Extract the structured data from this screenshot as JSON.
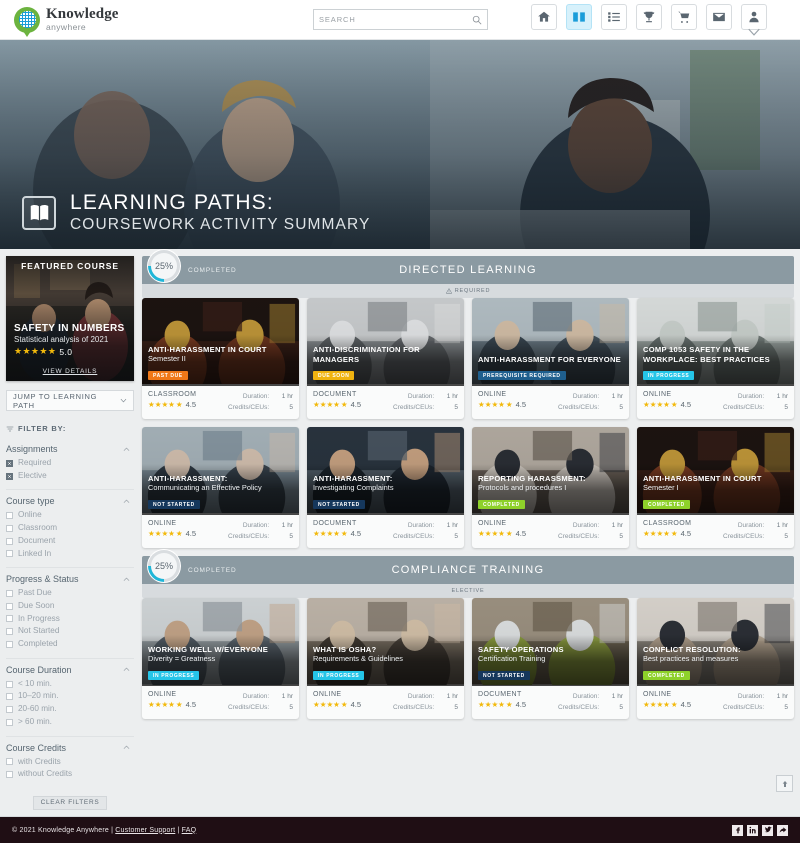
{
  "header": {
    "logo": {
      "line1": "Knowledge",
      "line2": "anywhere",
      "icon": "globe-logo-icon"
    },
    "search": {
      "placeholder": "SEARCH",
      "value": "",
      "icon": "search-icon"
    },
    "nav": [
      {
        "name": "home",
        "icon": "home-icon",
        "active": false
      },
      {
        "name": "catalog",
        "icon": "book-icon",
        "active": true
      },
      {
        "name": "transcript",
        "icon": "list-icon",
        "active": false
      },
      {
        "name": "achievements",
        "icon": "trophy-icon",
        "active": false
      },
      {
        "name": "store",
        "icon": "cart-icon",
        "active": false
      },
      {
        "name": "messages",
        "icon": "envelope-icon",
        "active": false
      },
      {
        "name": "account",
        "icon": "person-icon",
        "active": false
      }
    ]
  },
  "hero": {
    "icon": "open-book-icon",
    "title": "LEARNING PATHS:",
    "subtitle": "COURSEWORK ACTIVITY SUMMARY"
  },
  "sidebar": {
    "featured": {
      "label": "FEATURED COURSE",
      "title": "SAFETY IN NUMBERS",
      "subtitle": "Statistical analysis of 2021",
      "stars": "★★★★★",
      "rating": "5.0",
      "link": "VIEW DETAILS"
    },
    "jump_label": "JUMP TO LEARNING PATH",
    "filter_header": "FILTER BY:",
    "groups": [
      {
        "title": "Assignments",
        "options": [
          {
            "label": "Required",
            "checked": true
          },
          {
            "label": "Elective",
            "checked": true
          }
        ]
      },
      {
        "title": "Course type",
        "options": [
          {
            "label": "Online",
            "checked": false
          },
          {
            "label": "Classroom",
            "checked": false
          },
          {
            "label": "Document",
            "checked": false
          },
          {
            "label": "Linked In",
            "checked": false
          }
        ]
      },
      {
        "title": "Progress & Status",
        "options": [
          {
            "label": "Past Due",
            "checked": false
          },
          {
            "label": "Due Soon",
            "checked": false
          },
          {
            "label": "In Progress",
            "checked": false
          },
          {
            "label": "Not Started",
            "checked": false
          },
          {
            "label": "Completed",
            "checked": false
          }
        ]
      },
      {
        "title": "Course Duration",
        "options": [
          {
            "label": "< 10 min.",
            "checked": false
          },
          {
            "label": "10–20 min.",
            "checked": false
          },
          {
            "label": "20-60 min.",
            "checked": false
          },
          {
            "label": "> 60 min.",
            "checked": false
          }
        ]
      },
      {
        "title": "Course Credits",
        "options": [
          {
            "label": "with Credits",
            "checked": false
          },
          {
            "label": "without Credits",
            "checked": false
          }
        ]
      }
    ],
    "clear_label": "CLEAR FILTERS"
  },
  "sections": [
    {
      "percent": "25%",
      "completed_label": "COMPLETED",
      "title": "DIRECTED LEARNING",
      "subtitle": "REQUIRED",
      "subtitle_icon": "warning-icon",
      "rows": [
        [
          {
            "title": "ANTI-HARASSMENT IN COURT",
            "subtitle": "Semester II",
            "badge": "PAST DUE",
            "badge_color": "#f07818",
            "badge_text_color": "#ffffff",
            "type": "CLASSROOM",
            "stars": "★★★★",
            "half": "★",
            "rating": "4.5",
            "duration_label": "Duration:",
            "duration": "1 hr",
            "credits_label": "Credits/CEUs:",
            "credits": "5",
            "image": "gavel-dark"
          },
          {
            "title": "ANTI-DISCRIMINATION FOR MANAGERS",
            "subtitle": "",
            "badge": "DUE SOON",
            "badge_color": "#f0b310",
            "badge_text_color": "#ffffff",
            "type": "DOCUMENT",
            "stars": "★★★★",
            "half": "★",
            "rating": "4.5",
            "duration_label": "Duration:",
            "duration": "1 hr",
            "credits_label": "Credits/CEUs:",
            "credits": "5",
            "image": "meeting-table"
          },
          {
            "title": "ANTI-HARASSMENT FOR EVERYONE",
            "subtitle": "",
            "badge": "PREREQUISITE REQUIRED",
            "badge_color": "#1f5f8e",
            "badge_text_color": "#ffffff",
            "type": "ONLINE",
            "stars": "★★★★",
            "half": "★",
            "rating": "4.5",
            "duration_label": "Duration:",
            "duration": "1 hr",
            "credits_label": "Credits/CEUs:",
            "credits": "5",
            "image": "three-colleagues"
          },
          {
            "title": "COMP 1053 SAFETY IN THE WORKPLACE: BEST PRACTICES",
            "subtitle": "",
            "badge": "IN PROGRESS",
            "badge_color": "#25c5e8",
            "badge_text_color": "#ffffff",
            "type": "ONLINE",
            "stars": "★★★★",
            "half": "★",
            "rating": "4.5",
            "duration_label": "Duration:",
            "duration": "1 hr",
            "credits_label": "Credits/CEUs:",
            "credits": "5",
            "image": "desk-laptop"
          }
        ],
        [
          {
            "title": "ANTI-HARASSMENT:",
            "subtitle": "Communicating an Effective Policy",
            "badge": "NOT STARTED",
            "badge_color": "#15375c",
            "badge_text_color": "#ffffff",
            "type": "ONLINE",
            "stars": "★★★★",
            "half": "★",
            "rating": "4.5",
            "duration_label": "Duration:",
            "duration": "1 hr",
            "credits_label": "Credits/CEUs:",
            "credits": "5",
            "image": "window-two-women"
          },
          {
            "title": "ANTI-HARASSMENT:",
            "subtitle": "Investigating Complaints",
            "badge": "NOT STARTED",
            "badge_color": "#15375c",
            "badge_text_color": "#ffffff",
            "type": "DOCUMENT",
            "stars": "★★★★",
            "half": "★",
            "rating": "4.5",
            "duration_label": "Duration:",
            "duration": "1 hr",
            "credits_label": "Credits/CEUs:",
            "credits": "5",
            "image": "man-glasses"
          },
          {
            "title": "REPORTING HARASSMENT:",
            "subtitle": "Protocols and procedures I",
            "badge": "COMPLETED",
            "badge_color": "#8ed12a",
            "badge_text_color": "#ffffff",
            "type": "ONLINE",
            "stars": "★★★★",
            "half": "★",
            "rating": "4.5",
            "duration_label": "Duration:",
            "duration": "1 hr",
            "credits_label": "Credits/CEUs:",
            "credits": "5",
            "image": "two-women-office"
          },
          {
            "title": "ANTI-HARASSMENT IN COURT",
            "subtitle": "Semester I",
            "badge": "COMPLETED",
            "badge_color": "#8ed12a",
            "badge_text_color": "#ffffff",
            "type": "CLASSROOM",
            "stars": "★★★★",
            "half": "★",
            "rating": "4.5",
            "duration_label": "Duration:",
            "duration": "1 hr",
            "credits_label": "Credits/CEUs:",
            "credits": "5",
            "image": "gavel-dark"
          }
        ]
      ]
    },
    {
      "percent": "25%",
      "completed_label": "COMPLETED",
      "title": "COMPLIANCE TRAINING",
      "subtitle": "ELECTIVE",
      "subtitle_icon": "",
      "rows": [
        [
          {
            "title": "WORKING WELL W/EVERYONE",
            "subtitle": "Diverity = Greatness",
            "badge": "IN PROGRESS",
            "badge_color": "#25c5e8",
            "badge_text_color": "#ffffff",
            "type": "ONLINE",
            "stars": "★★★★",
            "half": "★",
            "rating": "4.5",
            "duration_label": "Duration:",
            "duration": "1 hr",
            "credits_label": "Credits/CEUs:",
            "credits": "5",
            "image": "team-office"
          },
          {
            "title": "WHAT IS OSHA?",
            "subtitle": "Requirements & Guidelines",
            "badge": "IN PROGRESS",
            "badge_color": "#25c5e8",
            "badge_text_color": "#ffffff",
            "type": "ONLINE",
            "stars": "★★★★",
            "half": "★",
            "rating": "4.5",
            "duration_label": "Duration:",
            "duration": "1 hr",
            "credits_label": "Credits/CEUs:",
            "credits": "5",
            "image": "warehouse-pair"
          },
          {
            "title": "SAFETY OPERATIONS",
            "subtitle": "Certification Training",
            "badge": "NOT STARTED",
            "badge_color": "#15375c",
            "badge_text_color": "#ffffff",
            "type": "DOCUMENT",
            "stars": "★★★★",
            "half": "★",
            "rating": "4.5",
            "duration_label": "Duration:",
            "duration": "1 hr",
            "credits_label": "Credits/CEUs:",
            "credits": "5",
            "image": "hardhats"
          },
          {
            "title": "CONFLICT RESOLUTION:",
            "subtitle": "Best practices and measures",
            "badge": "COMPLETED",
            "badge_color": "#8ed12a",
            "badge_text_color": "#ffffff",
            "type": "ONLINE",
            "stars": "★★★★",
            "half": "★",
            "rating": "4.5",
            "duration_label": "Duration:",
            "duration": "1 hr",
            "credits_label": "Credits/CEUs:",
            "credits": "5",
            "image": "woman-pointing"
          }
        ]
      ]
    }
  ],
  "footer": {
    "copyright": "© 2021 Knowledge Anywhere |",
    "support": "Customer Support",
    "sep": "|",
    "faq": "FAQ",
    "social": [
      "facebook-icon",
      "linkedin-icon",
      "twitter-icon",
      "share-icon"
    ]
  },
  "scroll_top_icon": "arrow-up-icon"
}
